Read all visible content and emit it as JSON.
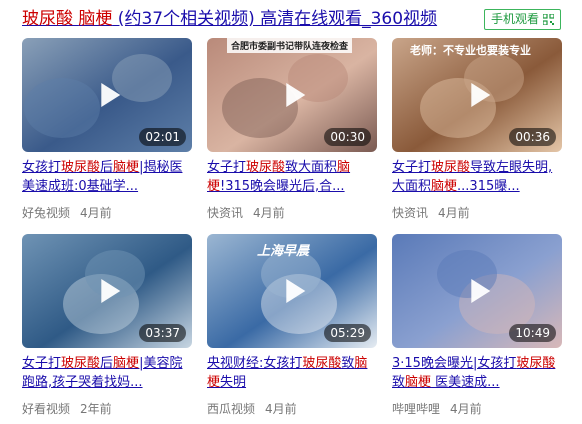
{
  "header": {
    "title_parts": [
      "玻尿酸",
      " ",
      "脑梗",
      " (约37个相关视频) 高清在线观看_360视频"
    ],
    "mobile_label": "手机观看"
  },
  "videos": [
    {
      "duration": "02:01",
      "title_segments": [
        {
          "t": "女孩打",
          "hl": false
        },
        {
          "t": "玻尿酸",
          "hl": true
        },
        {
          "t": "后",
          "hl": false
        },
        {
          "t": "脑梗",
          "hl": true
        },
        {
          "t": "|揭秘医美速成班:0基础学...",
          "hl": false
        }
      ],
      "source": "好兔视频",
      "time": "4月前",
      "overlay": "",
      "colors": [
        "#8aa0b8",
        "#3a5a8a",
        "#5e7fa8"
      ]
    },
    {
      "duration": "00:30",
      "title_segments": [
        {
          "t": "女子打",
          "hl": false
        },
        {
          "t": "玻尿酸",
          "hl": true
        },
        {
          "t": "致大面积",
          "hl": false
        },
        {
          "t": "脑梗",
          "hl": true
        },
        {
          "t": "!315晚会曝光后,合...",
          "hl": false
        }
      ],
      "source": "快资讯",
      "time": "4月前",
      "overlay": "合肥市委副书记带队连夜检查",
      "colors": [
        "#b98a7a",
        "#d9b4a2",
        "#7a5a52"
      ]
    },
    {
      "duration": "00:36",
      "title_segments": [
        {
          "t": "女子打",
          "hl": false
        },
        {
          "t": "玻尿酸",
          "hl": true
        },
        {
          "t": "导致左眼失明,大面积",
          "hl": false
        },
        {
          "t": "脑梗",
          "hl": true
        },
        {
          "t": "...315曝...",
          "hl": false
        }
      ],
      "source": "快资讯",
      "time": "4月前",
      "overlay": "老师：不专业也要装专业",
      "colors": [
        "#c9a58a",
        "#8a5a3a",
        "#e4c6a8"
      ]
    },
    {
      "duration": "03:37",
      "title_segments": [
        {
          "t": "女子打",
          "hl": false
        },
        {
          "t": "玻尿酸",
          "hl": true
        },
        {
          "t": "后",
          "hl": false
        },
        {
          "t": "脑梗",
          "hl": true
        },
        {
          "t": "|美容院跑路,孩子哭着找妈...",
          "hl": false
        }
      ],
      "source": "好看视频",
      "time": "2年前",
      "overlay": "",
      "colors": [
        "#6f93b4",
        "#2f5a86",
        "#c8d6e2"
      ]
    },
    {
      "duration": "05:29",
      "title_segments": [
        {
          "t": "央视财经:女孩打",
          "hl": false
        },
        {
          "t": "玻尿酸",
          "hl": true
        },
        {
          "t": "致",
          "hl": false
        },
        {
          "t": "脑梗",
          "hl": true
        },
        {
          "t": "失明",
          "hl": false
        }
      ],
      "source": "西瓜视频",
      "time": "4月前",
      "overlay": "上海早晨",
      "colors": [
        "#9bb6d2",
        "#3a6aa5",
        "#e6ecf2"
      ]
    },
    {
      "duration": "10:49",
      "title_segments": [
        {
          "t": "3·15晚会曝光|女孩打",
          "hl": false
        },
        {
          "t": "玻尿酸",
          "hl": true
        },
        {
          "t": "致",
          "hl": false
        },
        {
          "t": "脑梗",
          "hl": true
        },
        {
          "t": " 医美速成...",
          "hl": false
        }
      ],
      "source": "哔哩哔哩",
      "time": "4月前",
      "overlay": "",
      "colors": [
        "#5a7ab8",
        "#8aa0d0",
        "#d8b8b8"
      ]
    }
  ]
}
